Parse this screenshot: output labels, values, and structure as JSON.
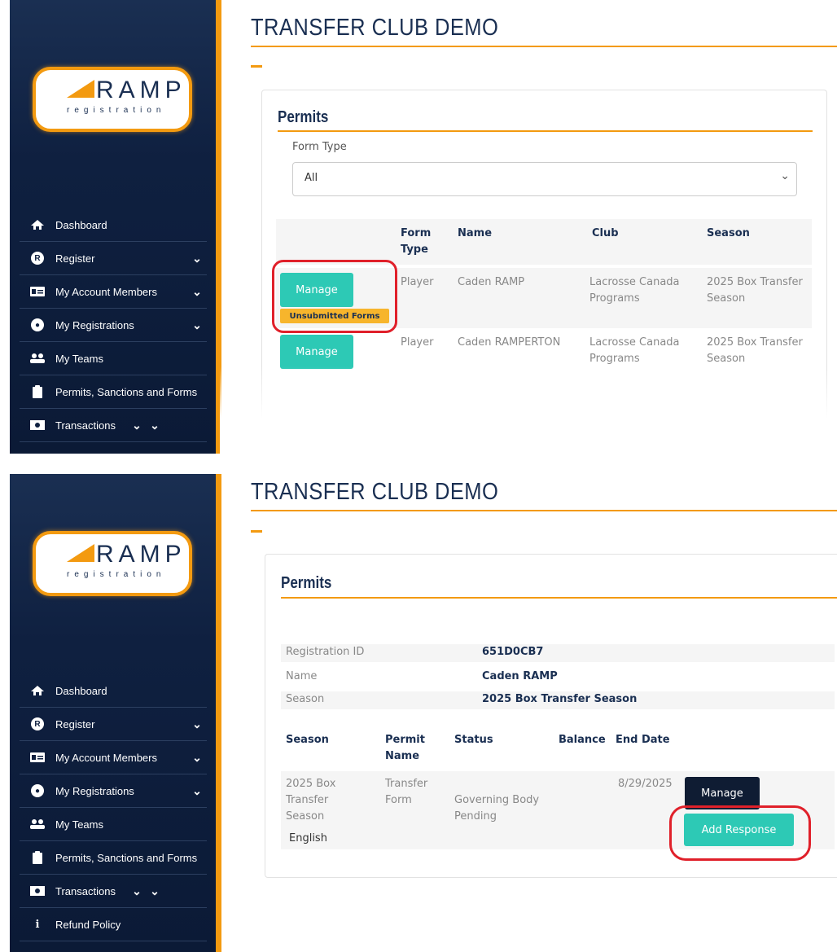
{
  "brand": {
    "logo_word": "RAMP",
    "logo_sub": "registration",
    "accent": "#f39a10",
    "navy": "#0f2040"
  },
  "nav": {
    "items": [
      {
        "label": "Dashboard",
        "icon": "home-icon"
      },
      {
        "label": "Register",
        "icon": "registered-icon"
      },
      {
        "label": "My Account Members",
        "icon": "id-card-icon"
      },
      {
        "label": "My Registrations",
        "icon": "user-circle-icon"
      },
      {
        "label": "My Teams",
        "icon": "users-icon"
      },
      {
        "label": "Permits, Sanctions and Forms",
        "icon": "clipboard-icon"
      },
      {
        "label": "Transactions",
        "icon": "money-icon"
      },
      {
        "label": "Refund Policy",
        "icon": "info-icon"
      }
    ]
  },
  "panel1": {
    "page_title": "TRANSFER CLUB DEMO",
    "card_title": "Permits",
    "form_type_label": "Form Type",
    "form_type_value": "All",
    "headers": [
      "Form Type",
      "Name",
      "Club",
      "Season"
    ],
    "rows": [
      {
        "button": "Manage",
        "badge": "Unsubmitted Forms",
        "form_type": "Player",
        "name": "Caden RAMP",
        "club": "Lacrosse Canada Programs",
        "season": "2025 Box Transfer Season"
      },
      {
        "button": "Manage",
        "form_type": "Player",
        "name": "Caden RAMPERTON",
        "club": "Lacrosse Canada Programs",
        "season": "2025 Box Transfer Season"
      }
    ]
  },
  "panel2": {
    "page_title": "TRANSFER CLUB DEMO",
    "card_title": "Permits",
    "info": [
      {
        "label": "Registration ID",
        "value": "651D0CB7"
      },
      {
        "label": "Name",
        "value": "Caden RAMP"
      },
      {
        "label": "Season",
        "value": "2025 Box Transfer Season"
      }
    ],
    "headers": [
      "Season",
      "Permit Name",
      "Status",
      "Balance",
      "End Date"
    ],
    "row": {
      "season": "2025 Box Transfer Season",
      "permit_name": "Transfer Form",
      "status": "Governing Body Pending",
      "balance": "",
      "end_date": "8/29/2025"
    },
    "manage_button": "Manage",
    "add_response_button": "Add Response",
    "language": "English"
  }
}
